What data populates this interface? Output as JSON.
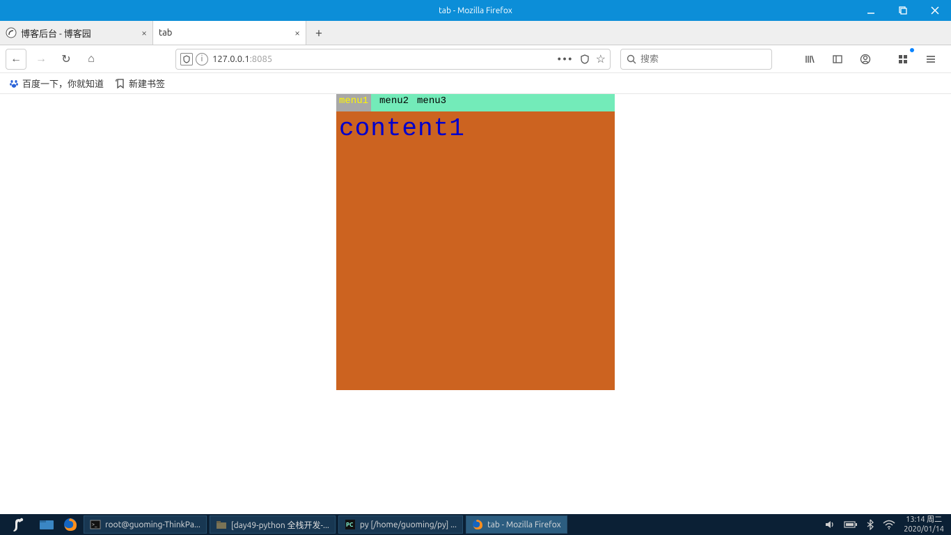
{
  "window": {
    "title": "tab - Mozilla Firefox"
  },
  "tabs": [
    {
      "title": "博客后台 - 博客园",
      "active": false
    },
    {
      "title": "tab",
      "active": true
    }
  ],
  "nav": {
    "back_icon": "←",
    "fwd_icon": "→",
    "reload_icon": "↻",
    "home_icon": "⌂"
  },
  "urlbar": {
    "host": "127.0.0.1",
    "port": ":8085",
    "dots": "•••",
    "shield": "⛨",
    "star": "☆"
  },
  "search": {
    "placeholder": "搜索",
    "icon": "🔍"
  },
  "bookmarks": [
    {
      "icon": "baidu",
      "label": "百度一下，你就知道"
    },
    {
      "icon": "add",
      "label": "新建书签"
    }
  ],
  "page": {
    "menus": [
      {
        "label": "menu1",
        "active": true
      },
      {
        "label": "menu2",
        "active": false
      },
      {
        "label": "menu3",
        "active": false
      }
    ],
    "content": "content1"
  },
  "taskbar": {
    "items": [
      {
        "icon": "term",
        "label": "root@guoming-ThinkPa..."
      },
      {
        "icon": "folder",
        "label": "[day49-python 全栈开发-..."
      },
      {
        "icon": "pc",
        "label": "py [/home/guoming/py] ..."
      },
      {
        "icon": "ff",
        "label": "tab - Mozilla Firefox",
        "active": true
      }
    ],
    "clock": {
      "time": "13:14 周二",
      "date": "2020/01/14"
    }
  },
  "toolbar_icons": {
    "library": "|||\\",
    "reader": "▭",
    "account": "◉",
    "addons": "⠿",
    "menu": "≡"
  }
}
